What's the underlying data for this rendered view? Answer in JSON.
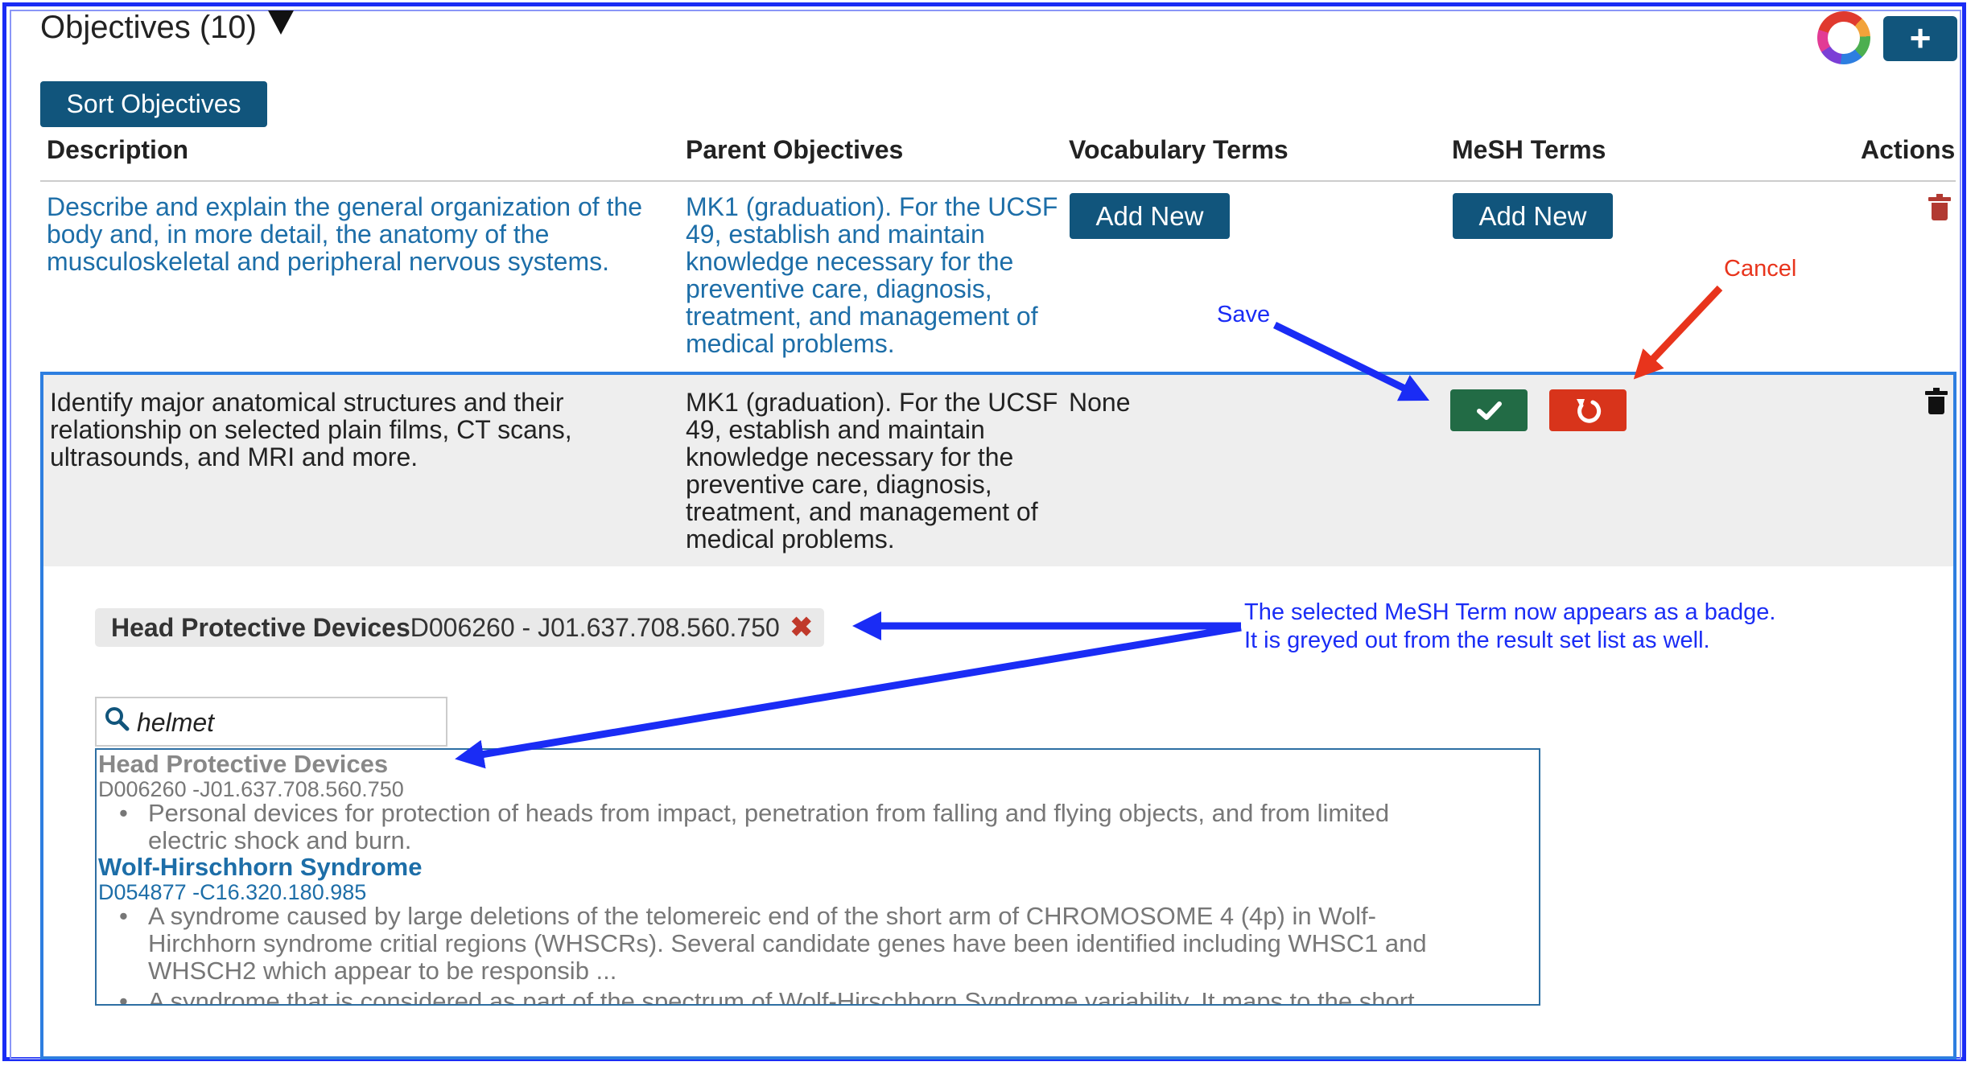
{
  "header": {
    "title": "Objectives (10)",
    "sort_label": "Sort Objectives",
    "add_icon": "plus-icon"
  },
  "columns": [
    "Description",
    "Parent Objectives",
    "Vocabulary Terms",
    "MeSH Terms",
    "Actions"
  ],
  "row1": {
    "description": [
      "Describe and explain the general organization of the",
      "body and, in more detail, the anatomy of the",
      "musculoskeletal and peripheral nervous systems."
    ],
    "parent": [
      "MK1 (graduation). For the UCSF",
      "49, establish and maintain",
      "knowledge necessary for the",
      "preventive care, diagnosis,",
      "treatment, and management of",
      "medical problems."
    ],
    "vocab_button": "Add New",
    "mesh_button": "Add New"
  },
  "row2": {
    "description": [
      "Identify major anatomical structures and their",
      "relationship on selected plain films, CT scans,",
      "ultrasounds, and MRI and more."
    ],
    "parent": [
      "MK1 (graduation). For the UCSF",
      "49, establish and maintain",
      "knowledge necessary for the",
      "preventive care, diagnosis,",
      "treatment, and management of",
      "medical problems."
    ],
    "vocab": "None"
  },
  "badge": {
    "name": "Head Protective Devices",
    "code": "D006260 - J01.637.708.560.750",
    "remove": "✖"
  },
  "search": {
    "value": "helmet"
  },
  "results": [
    {
      "title": "Head Protective Devices",
      "code": "D006260 -J01.637.708.560.750",
      "desc": [
        "Personal devices for protection of heads from impact, penetration from falling and flying objects, and from limited",
        "electric shock and burn."
      ]
    },
    {
      "title": "Wolf-Hirschhorn Syndrome",
      "code": "D054877 -C16.320.180.985",
      "desc": [
        "A syndrome caused by large deletions of the telomereic end of the short arm of CHROMOSOME 4 (4p) in Wolf-",
        "Hirchhorn syndrome critial regions (WHSCRs). Several candidate genes have been identified including WHSC1 and",
        "WHSCH2 which appear to be responsib ..."
      ],
      "desc2": "A syndrome that is considered as part of the spectrum of Wolf-Hirschhorn Syndrome variability. It maps to the short"
    }
  ],
  "annotations": {
    "save": "Save",
    "cancel": "Cancel",
    "badge_note_1": "The selected MeSH Term now appears as a badge.",
    "badge_note_2": "It is greyed out from the result set list as well."
  },
  "colors": {
    "primary": "#11557c",
    "save": "#226b45",
    "cancel": "#d8341b",
    "annotation_blue": "#1a2cf5",
    "annotation_red": "#e8341c",
    "link": "#1d6ea8"
  }
}
